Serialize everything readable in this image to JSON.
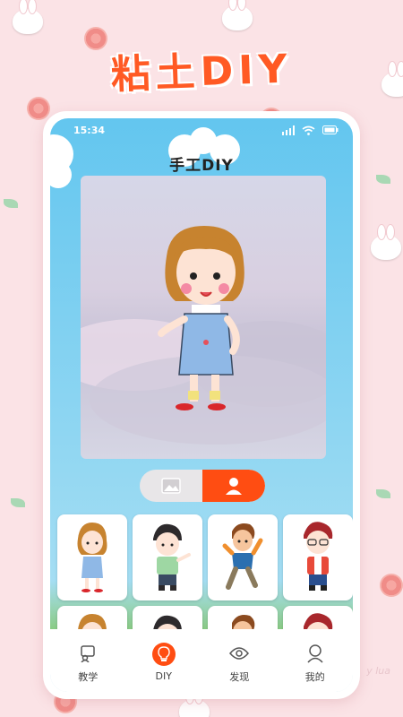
{
  "headline": "粘土DIY",
  "status_bar": {
    "time": "15:34"
  },
  "page_title": "手工DIY",
  "toggle": {
    "left_icon": "image-icon",
    "right_icon": "person-icon",
    "active": "right"
  },
  "characters": [
    {
      "name": "girl-blue-overalls"
    },
    {
      "name": "boy-green-shirt"
    },
    {
      "name": "boy-orange-jacket"
    },
    {
      "name": "boy-red-glasses"
    },
    {
      "name": "girl-blue-overalls"
    },
    {
      "name": "boy-green-shirt"
    },
    {
      "name": "boy-orange-jacket"
    },
    {
      "name": "boy-red-glasses"
    }
  ],
  "tabs": [
    {
      "label": "教学",
      "icon": "teach-icon",
      "active": false
    },
    {
      "label": "DIY",
      "icon": "diy-bulb-icon",
      "active": true
    },
    {
      "label": "发现",
      "icon": "discover-eye-icon",
      "active": false
    },
    {
      "label": "我的",
      "icon": "profile-icon",
      "active": false
    }
  ],
  "watermark": "y lua",
  "colors": {
    "accent": "#ff4d12",
    "headline": "#ff5a24",
    "background": "#fbe3e6",
    "sky": "#63c6ef"
  }
}
